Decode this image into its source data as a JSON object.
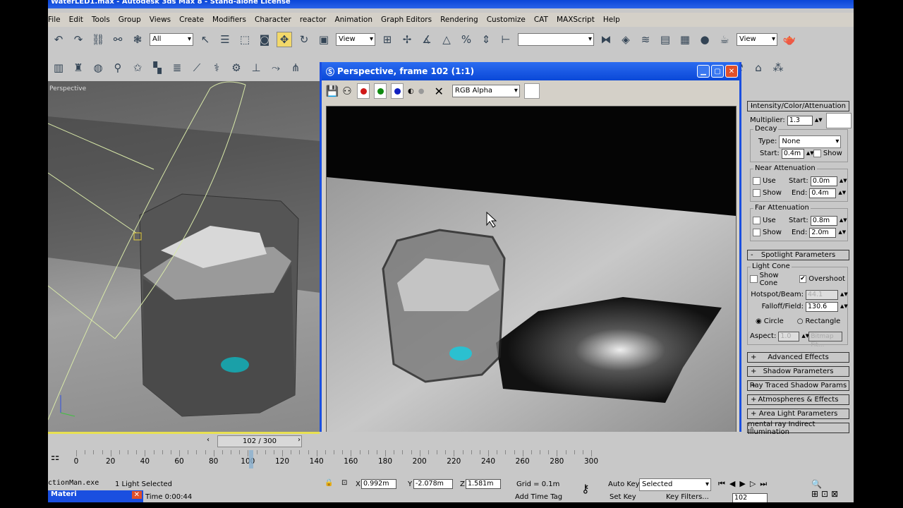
{
  "app": {
    "title": "WaterLED1.max - Autodesk 3ds Max 8 - Stand-alone License"
  },
  "menu": [
    "File",
    "Edit",
    "Tools",
    "Group",
    "Views",
    "Create",
    "Modifiers",
    "Character",
    "reactor",
    "Animation",
    "Graph Editors",
    "Rendering",
    "Customize",
    "CAT",
    "MAXScript",
    "Help"
  ],
  "toolbar": {
    "selection_filter": "All",
    "ref_coord": "View",
    "named_selection": "",
    "view_dropdown": "View"
  },
  "viewport": {
    "label": "Perspective"
  },
  "render_window": {
    "title": "Perspective, frame 102 (1:1)",
    "channel_dropdown": "RGB Alpha",
    "channel_colors": {
      "red": "#d01818",
      "green": "#108a10",
      "blue": "#1020c0"
    }
  },
  "command_panel": {
    "intensity": {
      "title": "Intensity/Color/Attenuation",
      "multiplier_label": "Multiplier:",
      "multiplier": "1.3",
      "decay_title": "Decay",
      "type_label": "Type:",
      "type": "None",
      "start_label": "Start:",
      "start": "0.4m",
      "show_label": "Show",
      "near_title": "Near Attenuation",
      "near_use": "Use",
      "near_show": "Show",
      "near_start_label": "Start:",
      "near_start": "0.0m",
      "near_end_label": "End:",
      "near_end": "0.4m",
      "far_title": "Far Attenuation",
      "far_use": "Use",
      "far_show": "Show",
      "far_start_label": "Start:",
      "far_start": "0.8m",
      "far_end_label": "End:",
      "far_end": "2.0m"
    },
    "spotlight": {
      "title": "Spotlight Parameters",
      "cone_title": "Light Cone",
      "show_cone": "Show Cone",
      "overshoot": "Overshoot",
      "overshoot_checked": true,
      "hotspot_label": "Hotspot/Beam:",
      "hotspot": "44.1",
      "falloff_label": "Falloff/Field:",
      "falloff": "130.6",
      "circle": "Circle",
      "rectangle": "Rectangle",
      "shape_selected": "Circle",
      "aspect_label": "Aspect:",
      "aspect": "1.0",
      "bitmap_fit": "Bitmap Fit..."
    },
    "rollouts": [
      {
        "sign": "+",
        "label": "Advanced Effects"
      },
      {
        "sign": "+",
        "label": "Shadow Parameters"
      },
      {
        "sign": "+",
        "label": "Ray Traced Shadow Params"
      },
      {
        "sign": "+",
        "label": "Atmospheres & Effects"
      },
      {
        "sign": "+",
        "label": "Area Light Parameters"
      },
      {
        "sign": "-",
        "label": "mental ray Indirect Illumination"
      }
    ]
  },
  "timeline": {
    "frame_display": "102 / 300",
    "current_frame": 102,
    "total_frames": 300,
    "ticks": [
      "0",
      "20",
      "40",
      "60",
      "80",
      "100",
      "120",
      "140",
      "160",
      "180",
      "200",
      "220",
      "240",
      "260",
      "280",
      "300"
    ]
  },
  "status": {
    "taskbar_item": "ctionMan.exe",
    "taskbar_window": "Materi",
    "selection": "1 Light Selected",
    "x_label": "X",
    "x": "0.992m",
    "y_label": "Y",
    "y": "-2.078m",
    "z_label": "Z",
    "z": "1.581m",
    "grid": "Grid = 0.1m",
    "time": "Time 0:00:44",
    "add_time_tag": "Add Time Tag",
    "auto_key": "Auto Key",
    "set_key": "Set Key",
    "key_mode": "Selected",
    "key_filters": "Key Filters...",
    "frame": "102"
  }
}
